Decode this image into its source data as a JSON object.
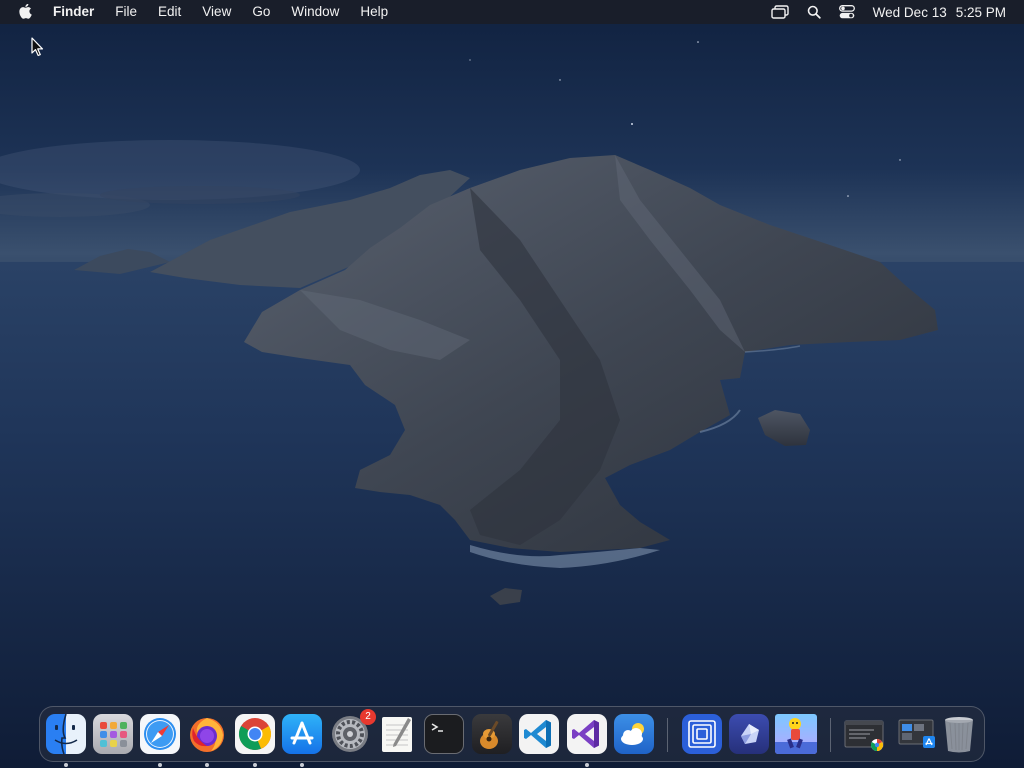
{
  "menubar": {
    "app_name": "Finder",
    "menus": [
      "File",
      "Edit",
      "View",
      "Go",
      "Window",
      "Help"
    ],
    "status_icons": [
      "screen-mirroring-icon",
      "spotlight-search-icon",
      "control-center-icon"
    ],
    "date": "Wed Dec 13",
    "time": "5:25 PM"
  },
  "dock": {
    "apps": [
      {
        "name": "Finder",
        "icon": "finder-icon",
        "running": true
      },
      {
        "name": "Launchpad",
        "icon": "launchpad-icon",
        "running": false
      },
      {
        "name": "Safari",
        "icon": "safari-icon",
        "running": true
      },
      {
        "name": "Firefox",
        "icon": "firefox-icon",
        "running": true
      },
      {
        "name": "Google Chrome",
        "icon": "chrome-icon",
        "running": true
      },
      {
        "name": "App Store",
        "icon": "app-store-icon",
        "running": true
      },
      {
        "name": "System Preferences",
        "icon": "system-preferences-icon",
        "running": false,
        "badge": "2"
      },
      {
        "name": "TextEdit",
        "icon": "textedit-icon",
        "running": false
      },
      {
        "name": "Terminal",
        "icon": "terminal-icon",
        "running": false
      },
      {
        "name": "GarageBand",
        "icon": "garageband-icon",
        "running": false
      },
      {
        "name": "Visual Studio Code",
        "icon": "vscode-icon",
        "running": false
      },
      {
        "name": "Visual Studio",
        "icon": "visual-studio-icon",
        "running": true
      },
      {
        "name": "Weather",
        "icon": "weather-icon",
        "running": false
      }
    ],
    "recent_apps": [
      {
        "name": "Screens",
        "icon": "screens-icon",
        "running": false
      },
      {
        "name": "Crystal App",
        "icon": "crystal-app-icon",
        "running": false
      },
      {
        "name": "Game",
        "icon": "game-character-icon",
        "running": false
      }
    ],
    "stacks": [
      {
        "name": "Downloads",
        "icon": "downloads-stack-icon"
      },
      {
        "name": "Applications",
        "icon": "applications-stack-icon"
      },
      {
        "name": "Trash",
        "icon": "trash-icon"
      }
    ]
  },
  "colors": {
    "menubar_bg": "#1a1e28",
    "badge": "#e8392f"
  }
}
